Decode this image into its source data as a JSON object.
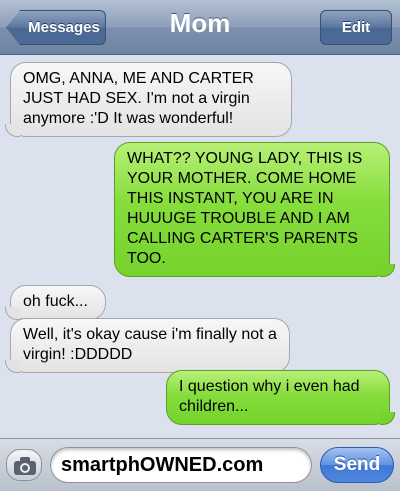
{
  "header": {
    "back_label": "Messages",
    "title": "Mom",
    "edit_label": "Edit"
  },
  "messages": [
    {
      "direction": "incoming",
      "text": "OMG, ANNA, ME AND CARTER JUST HAD SEX. I'm not a virgin anymore :'D It was wonderful!"
    },
    {
      "direction": "outgoing",
      "text": "WHAT?? YOUNG LADY, THIS IS YOUR MOTHER. COME HOME THIS INSTANT, YOU ARE IN HUUUGE TROUBLE AND I AM CALLING CARTER'S PARENTS TOO."
    },
    {
      "direction": "incoming",
      "text": "oh fuck..."
    },
    {
      "direction": "incoming",
      "text": "Well, it's okay cause i'm finally not a virgin! :DDDDD"
    },
    {
      "direction": "outgoing",
      "text": "I question why i even had children..."
    }
  ],
  "input": {
    "camera_icon": "camera-icon",
    "value": "smartphOWNED.com",
    "send_label": "Send"
  },
  "colors": {
    "incoming_bubble": "#e9e9e9",
    "outgoing_bubble": "#86dd3c",
    "navbar": "#8c9fb9",
    "background": "#dbe2ed",
    "send_button": "#4f86df"
  }
}
